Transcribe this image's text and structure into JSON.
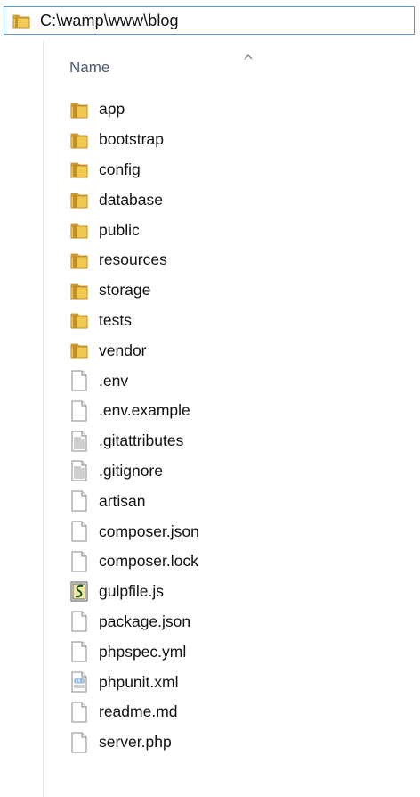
{
  "address_bar": {
    "path": "C:\\wamp\\www\\blog",
    "icon": "folder-icon"
  },
  "list_header": {
    "name_label": "Name",
    "sort": "ascending"
  },
  "items": [
    {
      "name": "app",
      "type": "folder",
      "icon": "folder-icon"
    },
    {
      "name": "bootstrap",
      "type": "folder",
      "icon": "folder-icon"
    },
    {
      "name": "config",
      "type": "folder",
      "icon": "folder-icon"
    },
    {
      "name": "database",
      "type": "folder",
      "icon": "folder-icon"
    },
    {
      "name": "public",
      "type": "folder",
      "icon": "folder-icon"
    },
    {
      "name": "resources",
      "type": "folder",
      "icon": "folder-icon"
    },
    {
      "name": "storage",
      "type": "folder",
      "icon": "folder-icon"
    },
    {
      "name": "tests",
      "type": "folder",
      "icon": "folder-icon"
    },
    {
      "name": "vendor",
      "type": "folder",
      "icon": "folder-icon"
    },
    {
      "name": ".env",
      "type": "file",
      "icon": "blank-file-icon"
    },
    {
      "name": ".env.example",
      "type": "file",
      "icon": "blank-file-icon"
    },
    {
      "name": ".gitattributes",
      "type": "text",
      "icon": "text-file-icon"
    },
    {
      "name": ".gitignore",
      "type": "text",
      "icon": "text-file-icon"
    },
    {
      "name": "artisan",
      "type": "file",
      "icon": "blank-file-icon"
    },
    {
      "name": "composer.json",
      "type": "file",
      "icon": "blank-file-icon"
    },
    {
      "name": "composer.lock",
      "type": "file",
      "icon": "blank-file-icon"
    },
    {
      "name": "gulpfile.js",
      "type": "script",
      "icon": "script-file-icon"
    },
    {
      "name": "package.json",
      "type": "file",
      "icon": "blank-file-icon"
    },
    {
      "name": "phpspec.yml",
      "type": "file",
      "icon": "blank-file-icon"
    },
    {
      "name": "phpunit.xml",
      "type": "xml",
      "icon": "xml-file-icon"
    },
    {
      "name": "readme.md",
      "type": "file",
      "icon": "blank-file-icon"
    },
    {
      "name": "server.php",
      "type": "file",
      "icon": "blank-file-icon"
    }
  ],
  "colors": {
    "folder_yellow": "#e8b93a",
    "folder_dark": "#c8952a",
    "address_border": "#5b9bd5",
    "header_text": "#4b5a75"
  }
}
